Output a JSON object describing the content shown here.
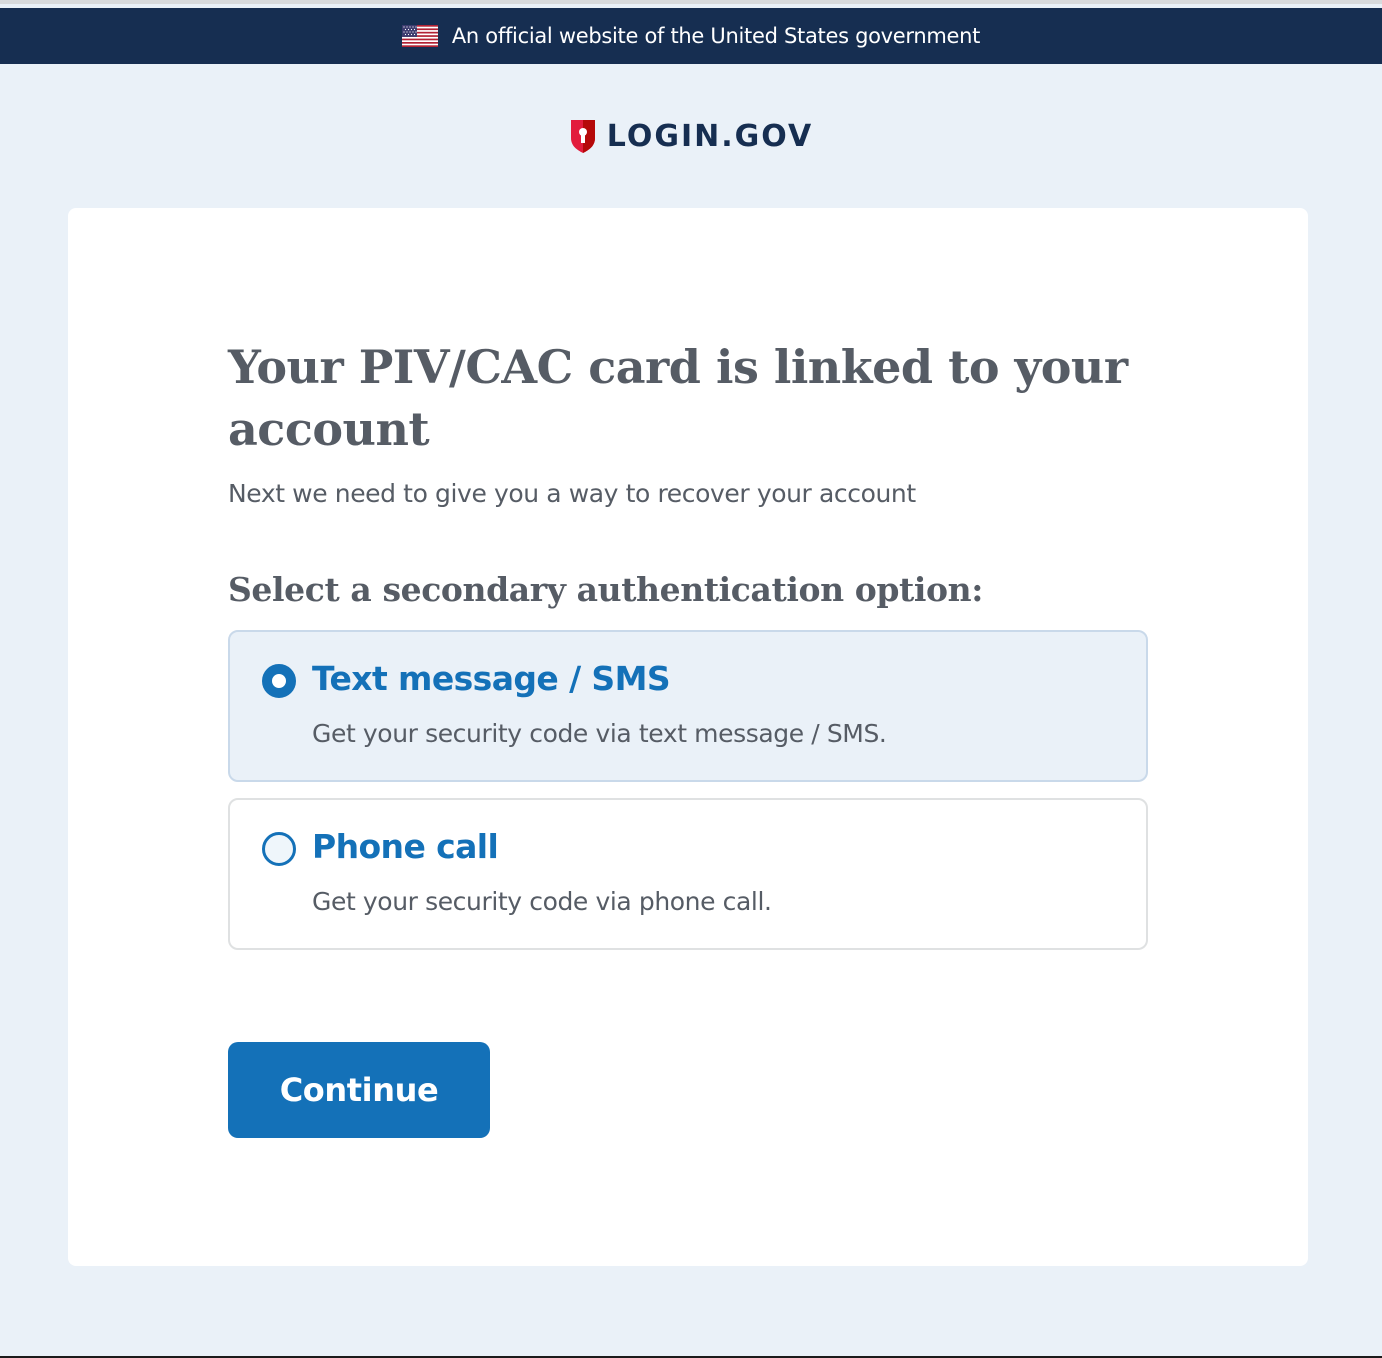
{
  "gov_banner": {
    "text": "An official website of the United States government",
    "flag_icon": "us-flag-icon"
  },
  "logo": {
    "icon": "shield-keyhole-icon",
    "text": "LOGIN.GOV"
  },
  "main": {
    "title": "Your PIV/CAC card is linked to your account",
    "subtitle": "Next we need to give you a way to recover your account",
    "section_heading": "Select a secondary authentication option:",
    "options": [
      {
        "label": "Text message / SMS",
        "description": "Get your security code via text message / SMS.",
        "selected": true
      },
      {
        "label": "Phone call",
        "description": "Get your security code via phone call.",
        "selected": false
      }
    ],
    "continue_label": "Continue"
  },
  "colors": {
    "banner_bg": "#162e51",
    "page_bg": "#eaf1f8",
    "primary": "#1471b8",
    "text_gray": "#565c65",
    "logo_red": "#e21c3d"
  }
}
